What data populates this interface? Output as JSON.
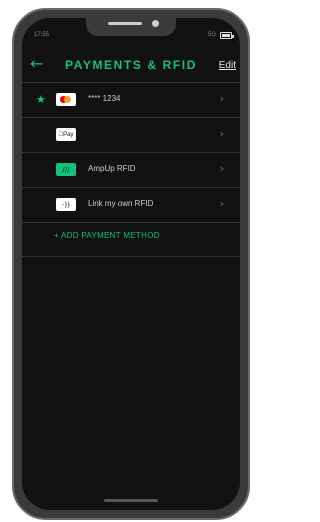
{
  "status_bar": {
    "time": "17:55",
    "network": "5G"
  },
  "header": {
    "back_icon": "arrow-left-icon",
    "title": "PAYMENTS & RFID",
    "edit_label": "Edit"
  },
  "payment_methods": [
    {
      "type": "mastercard",
      "label": "**** 1234",
      "default": true
    },
    {
      "type": "apple-pay",
      "badge": "Pay",
      "label": ""
    },
    {
      "type": "ampup-rfid",
      "badge": "///",
      "label": "AmpUp RFID"
    },
    {
      "type": "link-rfid",
      "badge": "·))",
      "label": "Link my own RFID"
    }
  ],
  "add_payment_label": "+ ADD PAYMENT METHOD",
  "colors": {
    "accent": "#12c27b",
    "background": "#111111"
  }
}
